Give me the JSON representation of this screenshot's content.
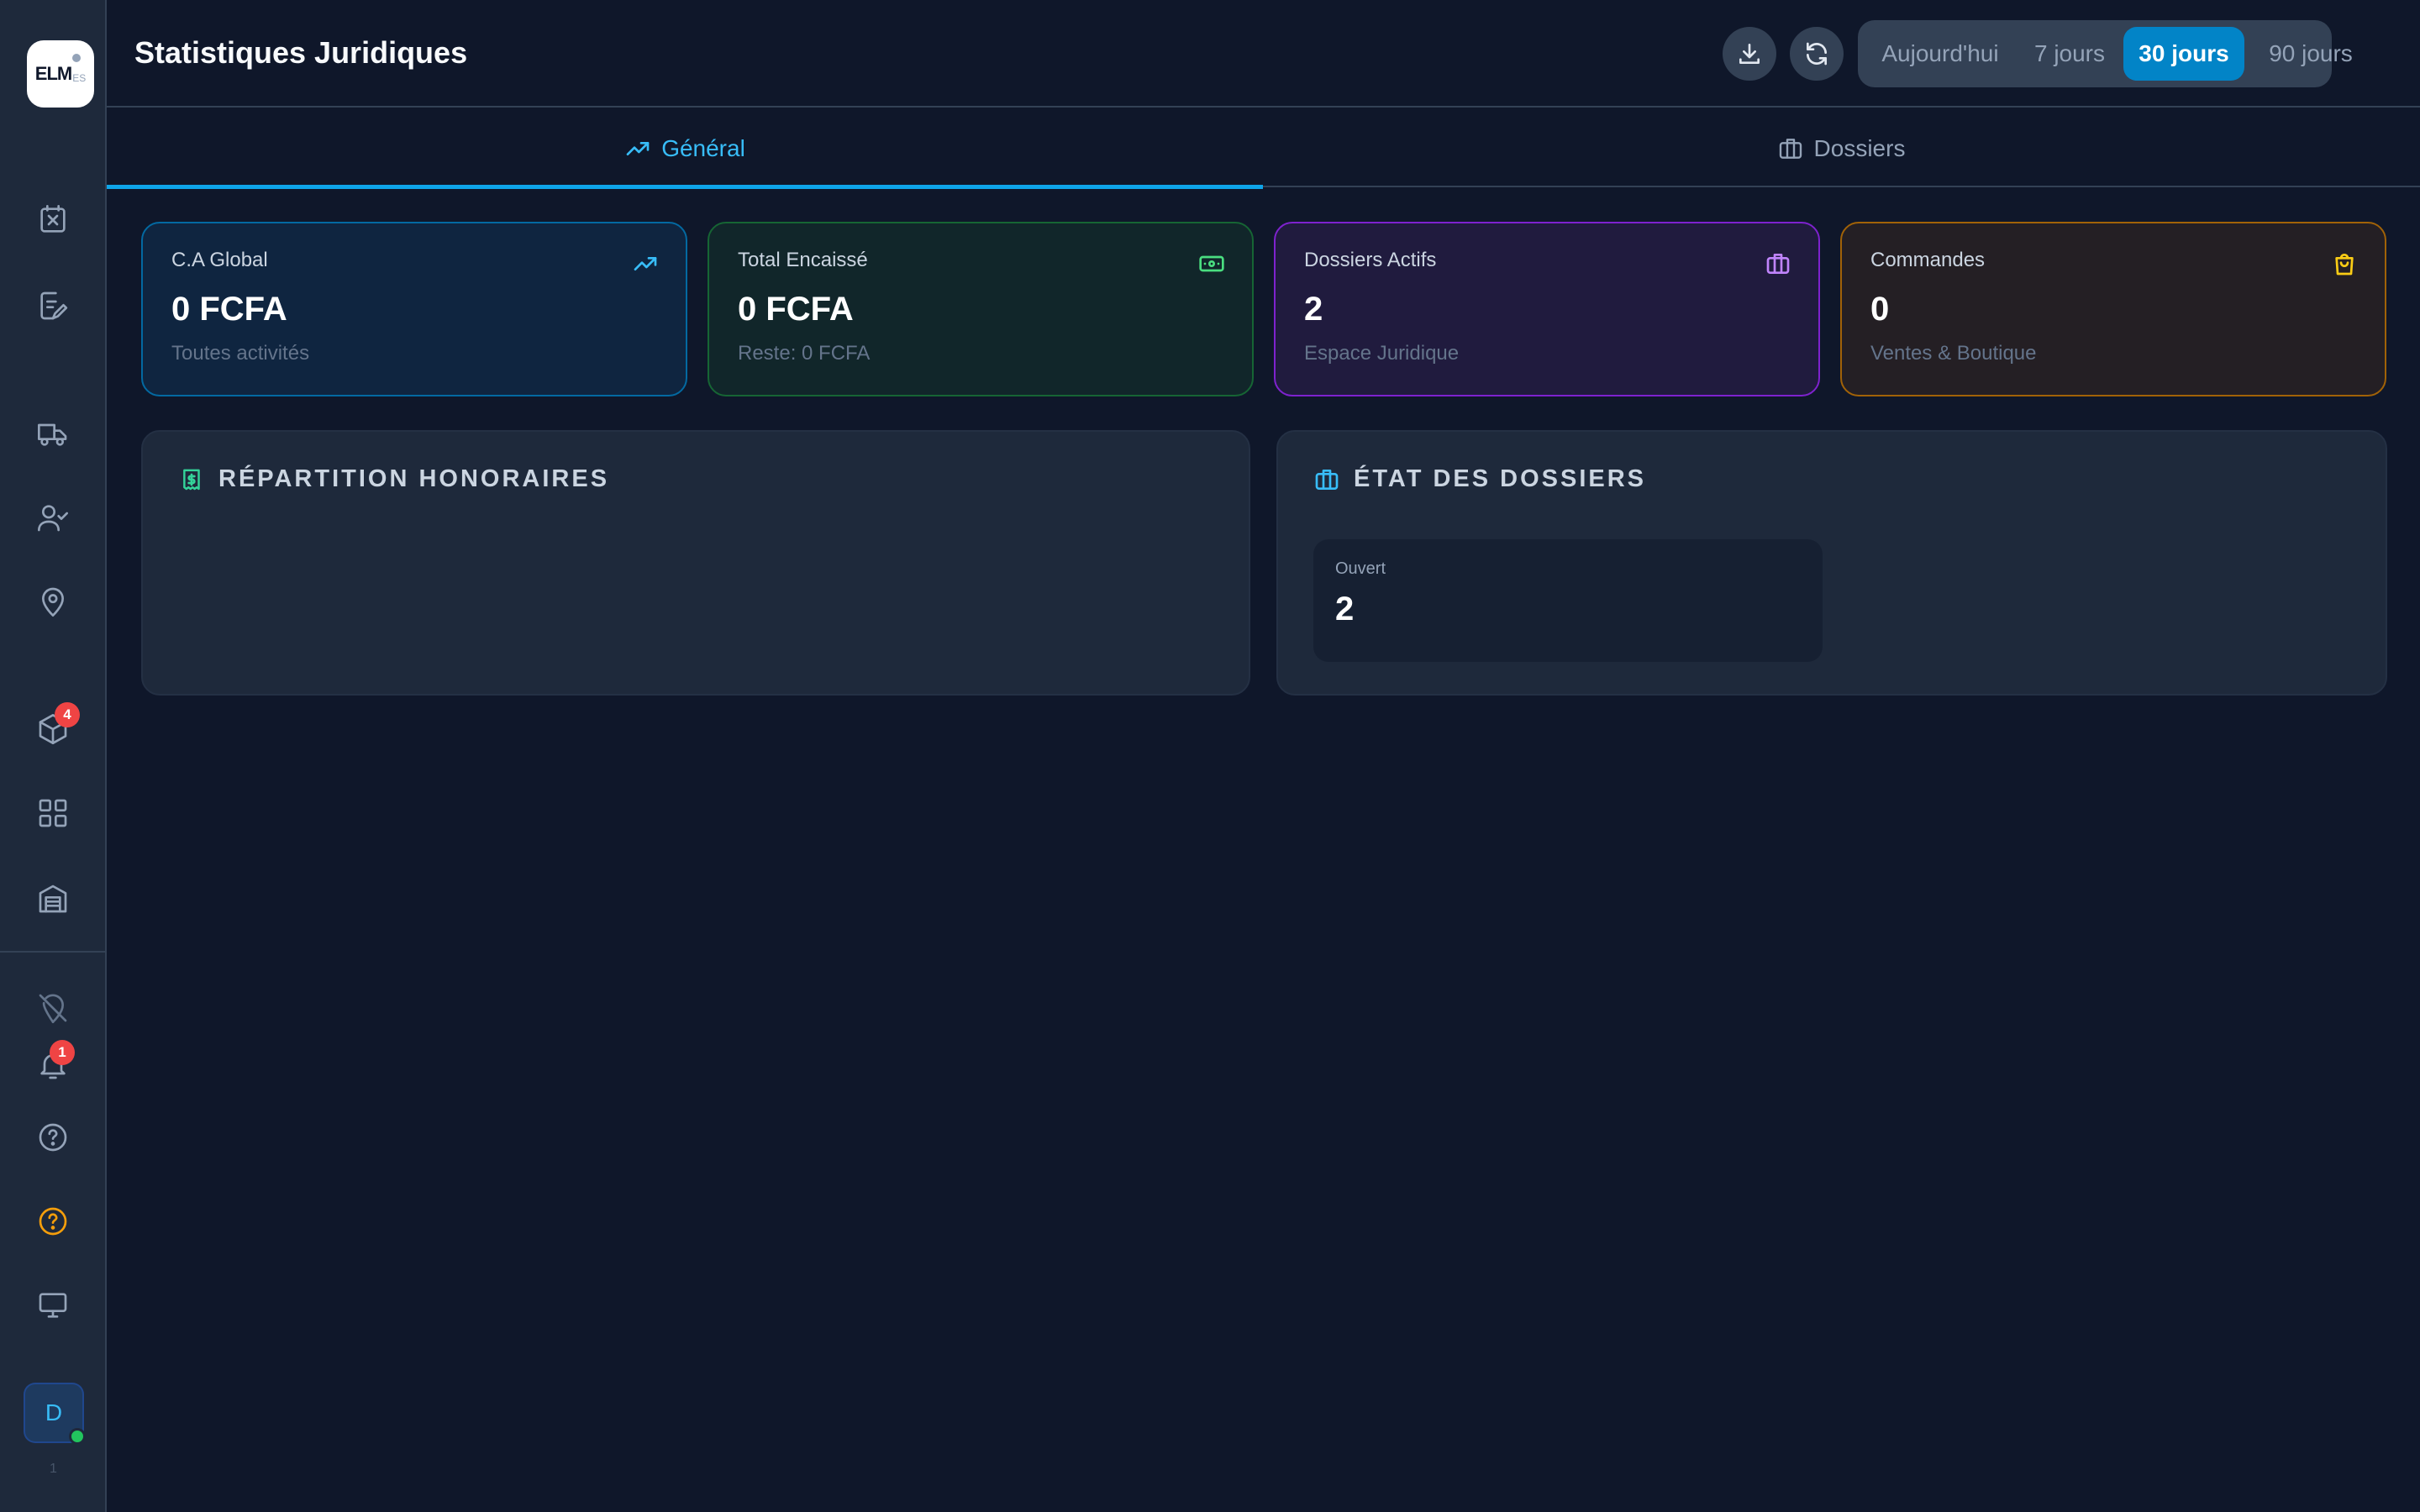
{
  "app": {
    "logo_text": "ELM",
    "logo_sub": "ES"
  },
  "sidebar": {
    "items": [
      {
        "icon": "task-x-icon"
      },
      {
        "icon": "file-edit-icon"
      },
      {
        "icon": "truck-icon"
      },
      {
        "icon": "user-check-icon"
      },
      {
        "icon": "map-pin-icon"
      },
      {
        "icon": "package-icon",
        "badge": "4"
      },
      {
        "icon": "grid-icon"
      },
      {
        "icon": "warehouse-icon"
      }
    ],
    "bottom": [
      {
        "icon": "location-off-icon"
      },
      {
        "icon": "bell-icon",
        "badge": "1"
      },
      {
        "icon": "help-circle-icon"
      },
      {
        "icon": "help-circle-amber-icon"
      },
      {
        "icon": "monitor-icon"
      }
    ],
    "avatar_initial": "D",
    "footer": "1"
  },
  "header": {
    "title": "Statistiques Juridiques",
    "ranges": [
      "Aujourd'hui",
      "7 jours",
      "30 jours",
      "90 jours"
    ],
    "active_range": "30 jours"
  },
  "tabs": [
    {
      "label": "Général",
      "icon": "trending-up-icon",
      "active": true
    },
    {
      "label": "Dossiers",
      "icon": "briefcase-icon",
      "active": false
    }
  ],
  "cards": [
    {
      "label": "C.A Global",
      "value": "0 FCFA",
      "sub": "Toutes activités",
      "icon": "trending-up-icon",
      "color": "#0ea5e9"
    },
    {
      "label": "Total Encaissé",
      "value": "0 FCFA",
      "sub": "Reste: 0 FCFA",
      "icon": "banknote-icon",
      "color": "#22c55e"
    },
    {
      "label": "Dossiers Actifs",
      "value": "2",
      "sub": "Espace Juridique",
      "icon": "briefcase-icon",
      "color": "#a855f7"
    },
    {
      "label": "Commandes",
      "value": "0",
      "sub": "Ventes & Boutique",
      "icon": "shopping-bag-icon",
      "color": "#eab308"
    }
  ],
  "panels": {
    "honoraires": {
      "title": "RÉPARTITION HONORAIRES",
      "icon": "receipt-dollar-icon"
    },
    "dossiers": {
      "title": "ÉTAT DES DOSSIERS",
      "icon": "briefcase-icon",
      "status": {
        "label": "Ouvert",
        "value": "2"
      }
    }
  }
}
